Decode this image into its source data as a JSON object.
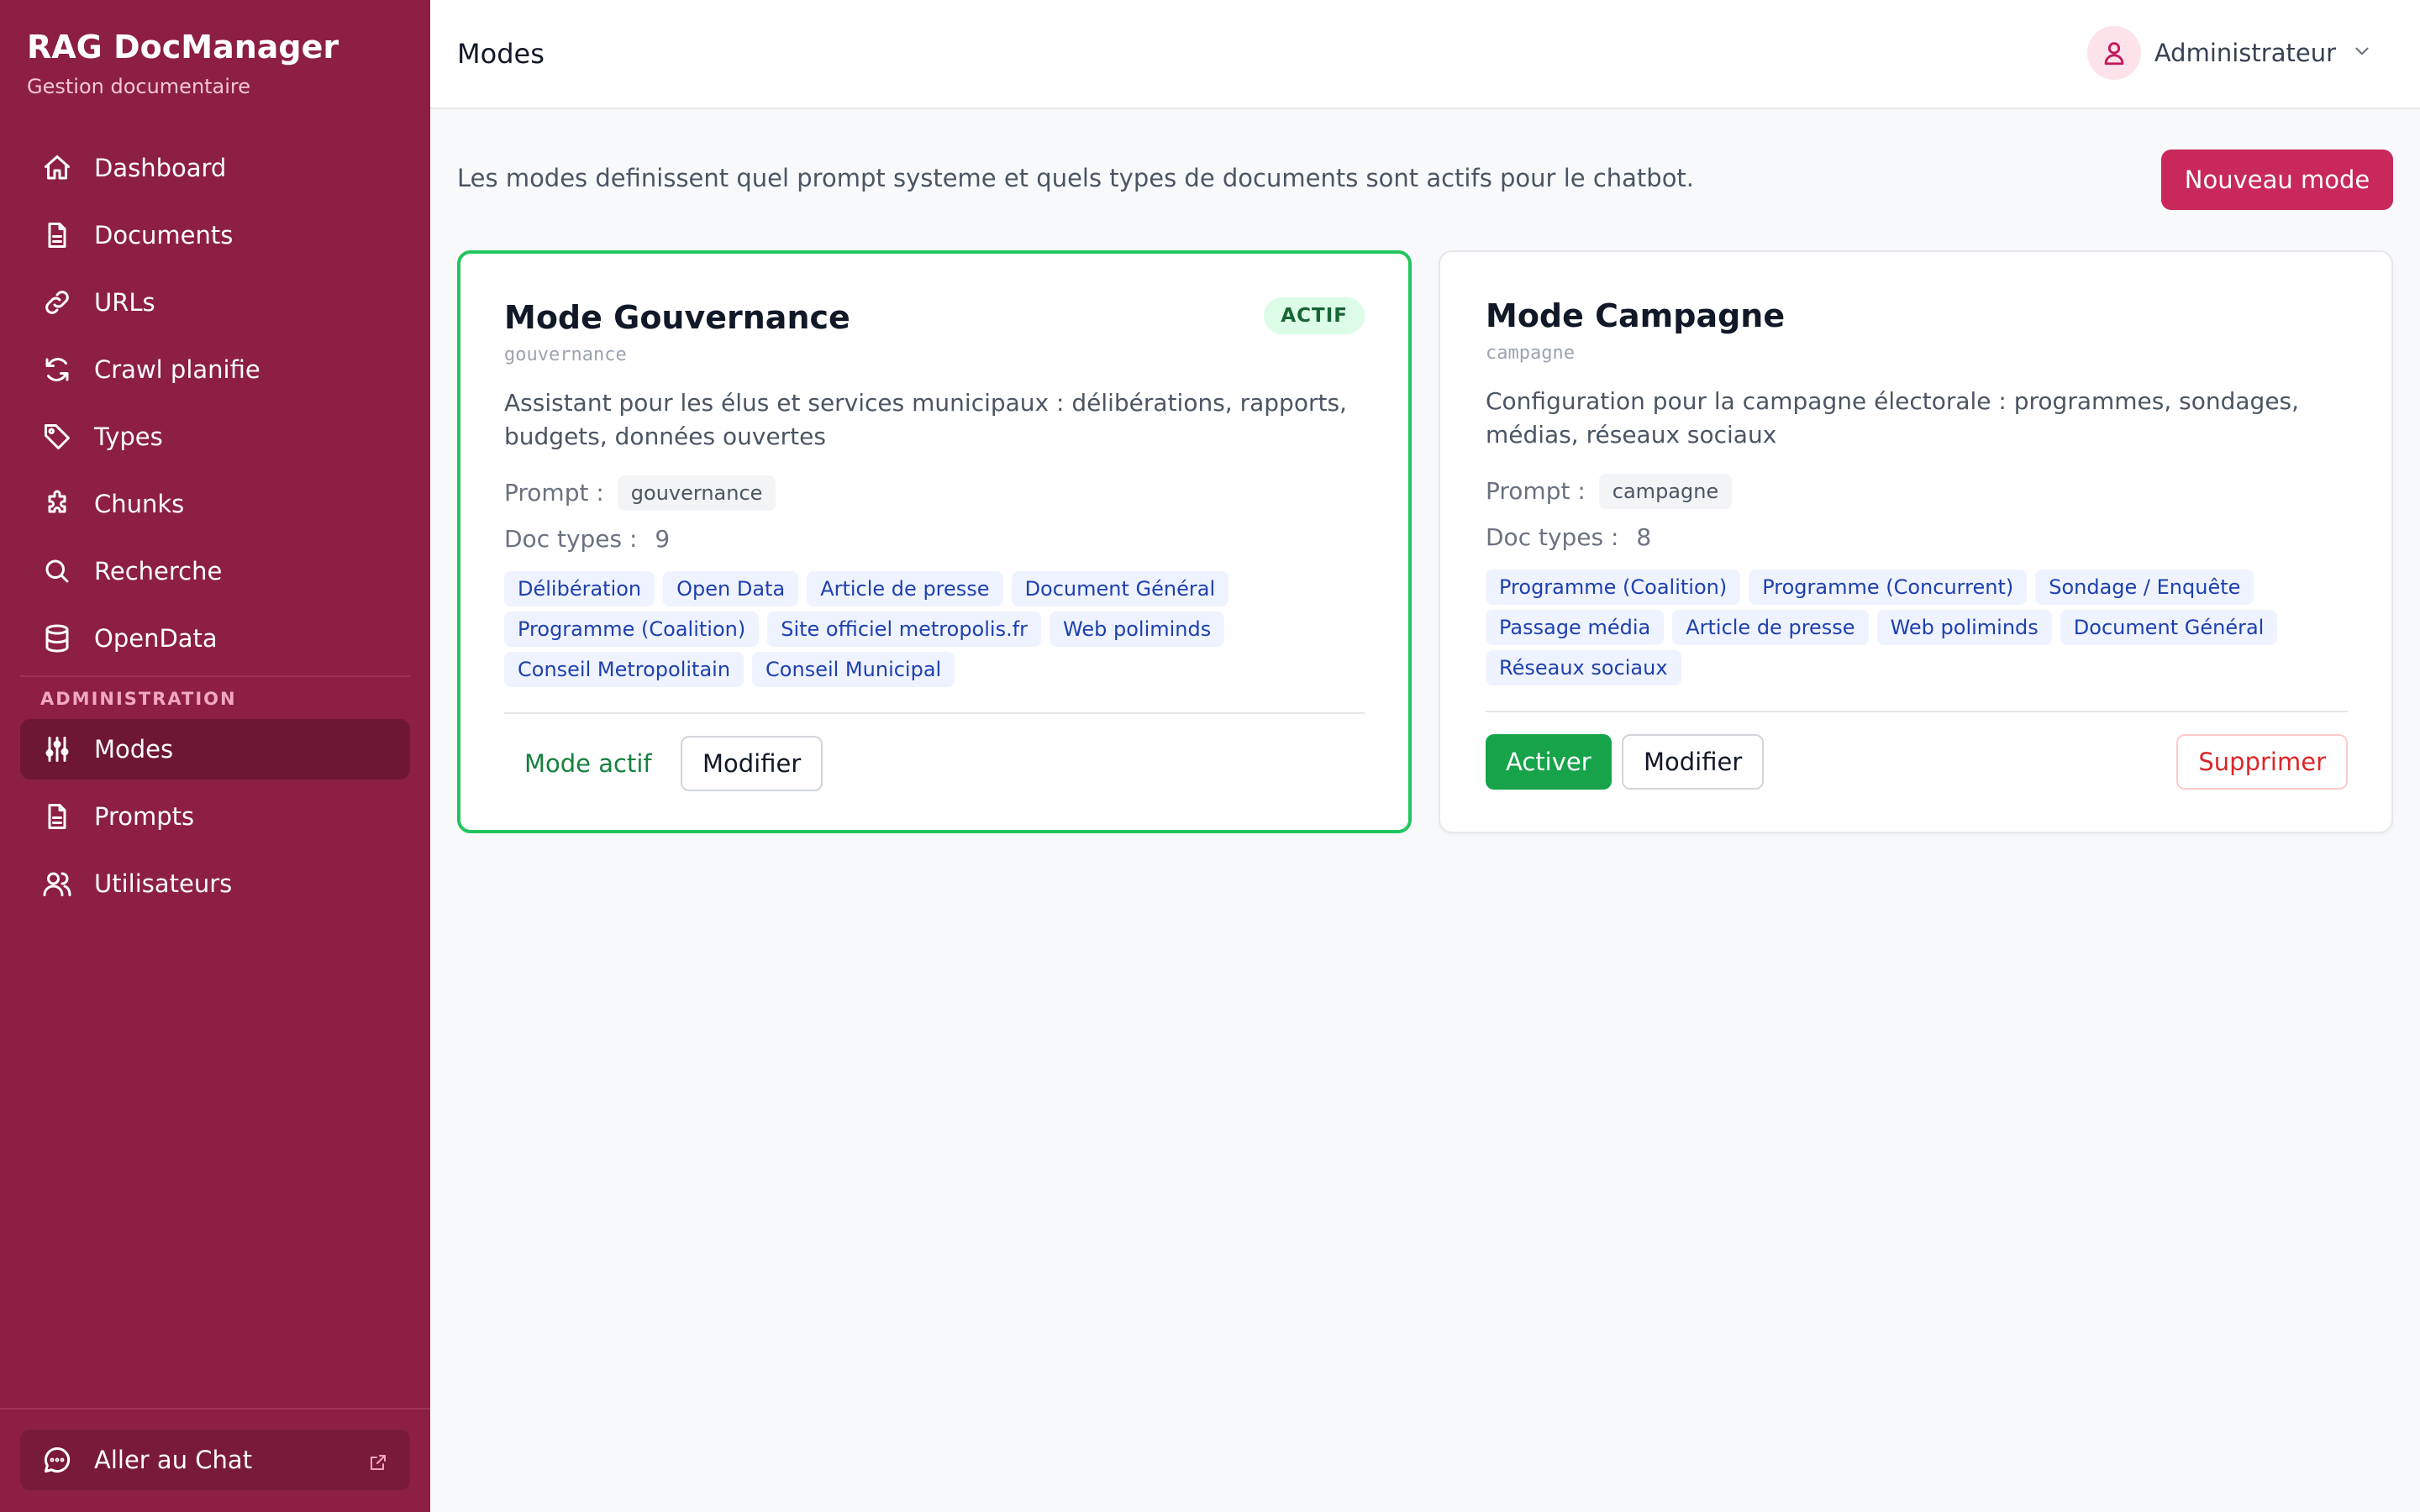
{
  "sidebar": {
    "brand_title": "RAG DocManager",
    "brand_subtitle": "Gestion documentaire",
    "items": [
      {
        "label": "Dashboard",
        "icon": "home-icon"
      },
      {
        "label": "Documents",
        "icon": "document-icon"
      },
      {
        "label": "URLs",
        "icon": "link-icon"
      },
      {
        "label": "Crawl planifie",
        "icon": "refresh-icon"
      },
      {
        "label": "Types",
        "icon": "tag-icon"
      },
      {
        "label": "Chunks",
        "icon": "puzzle-icon"
      },
      {
        "label": "Recherche",
        "icon": "search-icon"
      },
      {
        "label": "OpenData",
        "icon": "database-icon"
      }
    ],
    "admin_section": "ADMINISTRATION",
    "admin_items": [
      {
        "label": "Modes",
        "icon": "sliders-icon",
        "active": true
      },
      {
        "label": "Prompts",
        "icon": "document-icon"
      },
      {
        "label": "Utilisateurs",
        "icon": "users-icon"
      }
    ],
    "chat_link": "Aller au Chat"
  },
  "header": {
    "title": "Modes",
    "user_name": "Administrateur"
  },
  "main": {
    "intro": "Les modes definissent quel prompt systeme et quels types de documents sont actifs pour le chatbot.",
    "new_mode_label": "Nouveau mode",
    "prompt_label": "Prompt :",
    "doc_types_label": "Doc types :",
    "cards": [
      {
        "title": "Mode Gouvernance",
        "slug": "gouvernance",
        "badge": "ACTIF",
        "description": "Assistant pour les élus et services municipaux : délibérations, rapports, budgets, données ouvertes",
        "prompt": "gouvernance",
        "doc_type_count": "9",
        "doc_types": [
          "Délibération",
          "Open Data",
          "Article de presse",
          "Document Général",
          "Programme (Coalition)",
          "Site officiel metropolis.fr",
          "Web poliminds",
          "Conseil Metropolitain",
          "Conseil Municipal"
        ],
        "active_text": "Mode actif",
        "edit_label": "Modifier"
      },
      {
        "title": "Mode Campagne",
        "slug": "campagne",
        "description": "Configuration pour la campagne électorale : programmes, sondages, médias, réseaux sociaux",
        "prompt": "campagne",
        "doc_type_count": "8",
        "doc_types": [
          "Programme (Coalition)",
          "Programme (Concurrent)",
          "Sondage / Enquête",
          "Passage média",
          "Article de presse",
          "Web poliminds",
          "Document Général",
          "Réseaux sociaux"
        ],
        "activate_label": "Activer",
        "edit_label": "Modifier",
        "delete_label": "Supprimer"
      }
    ]
  },
  "colors": {
    "sidebar_bg": "#8c1f43",
    "active_nav": "#6e1734",
    "primary": "#c8285a",
    "active_border": "#22c55e",
    "activate_button": "#16a34a"
  }
}
